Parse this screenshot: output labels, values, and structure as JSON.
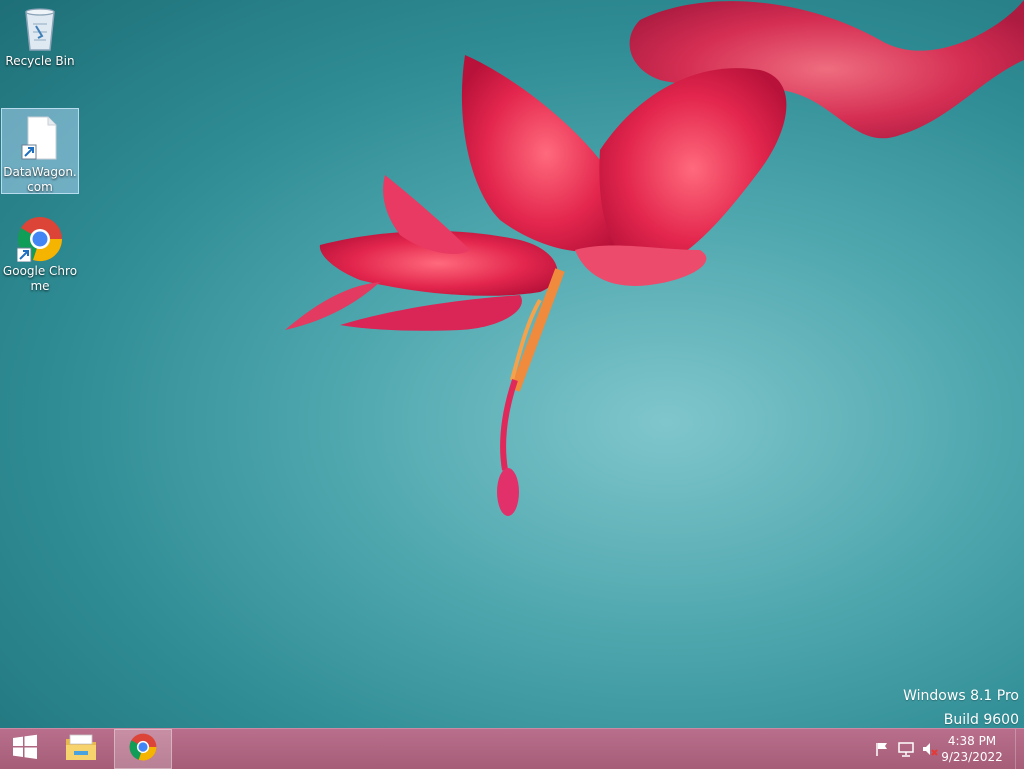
{
  "desktop": {
    "icons": [
      {
        "label": "Recycle Bin",
        "icon": "recycle-bin-icon"
      },
      {
        "label": "DataWagon.com",
        "icon": "document-shortcut-icon"
      },
      {
        "label": "Google Chrome",
        "icon": "chrome-icon"
      }
    ]
  },
  "watermark": {
    "line1": "Windows 8.1 Pro",
    "line2": "Build 9600"
  },
  "taskbar": {
    "start_icon": "windows-start-icon",
    "pinned": [
      {
        "name": "File Explorer",
        "icon": "folder-icon"
      },
      {
        "name": "Google Chrome",
        "icon": "chrome-icon",
        "active": true
      }
    ],
    "tray": {
      "icons": [
        "flag-icon",
        "network-icon",
        "volume-muted-icon"
      ],
      "time": "4:38 PM",
      "date": "9/23/2022"
    }
  },
  "colors": {
    "taskbar": "#a55d78",
    "wallpaper": "#4fa7ae",
    "flower": "#e0284f"
  }
}
